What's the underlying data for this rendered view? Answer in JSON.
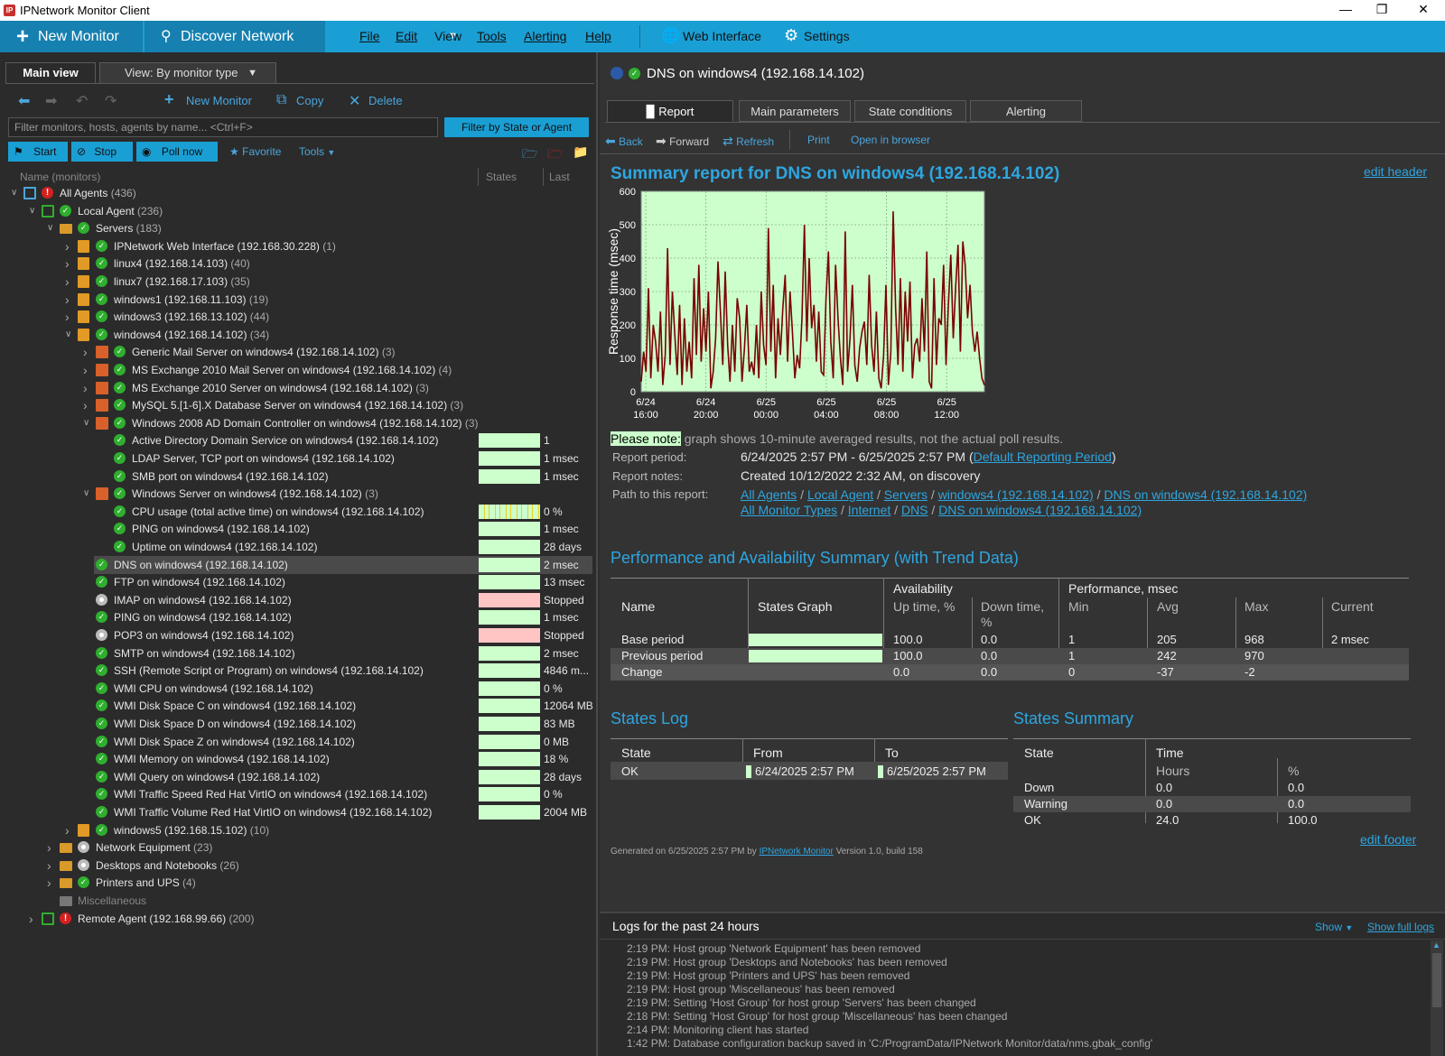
{
  "window": {
    "title": "IPNetwork Monitor Client",
    "logo": "IP"
  },
  "toolbar": {
    "new_monitor": "New Monitor",
    "discover": "Discover Network",
    "menus": [
      "File",
      "Edit",
      "View",
      "Tools",
      "Alerting",
      "Help"
    ],
    "web_interface": "Web Interface",
    "settings": "Settings"
  },
  "left": {
    "tab_main": "Main view",
    "tab_view": "View: By monitor type",
    "nav_new": "New Monitor",
    "nav_copy": "Copy",
    "nav_delete": "Delete",
    "filter_placeholder": "Filter monitors, hosts, agents by name... <Ctrl+F>",
    "filter_btn": "Filter by State or Agent",
    "btn_start": "Start",
    "btn_stop": "Stop",
    "btn_poll": "Poll now",
    "btn_favorite": "Favorite",
    "btn_tools": "Tools",
    "col_name": "Name (monitors)",
    "col_graph": "States Grap",
    "col_result": "Last Resu",
    "tree": [
      {
        "label": "All Agents",
        "count": "(436)",
        "level": 0,
        "icon": "agents",
        "status": "err",
        "expanded": true
      },
      {
        "label": "Local Agent",
        "count": "(236)",
        "level": 1,
        "icon": "agent",
        "status": "ok",
        "expanded": true
      },
      {
        "label": "Servers",
        "count": "(183)",
        "level": 2,
        "icon": "folder",
        "status": "ok",
        "expanded": true
      },
      {
        "label": "IPNetwork Web Interface (192.168.30.228)",
        "count": "(1)",
        "level": 3,
        "icon": "server",
        "status": "ok",
        "expanded": false
      },
      {
        "label": "linux4 (192.168.14.103)",
        "count": "(40)",
        "level": 3,
        "icon": "server",
        "status": "ok",
        "expanded": false
      },
      {
        "label": "linux7 (192.168.17.103)",
        "count": "(35)",
        "level": 3,
        "icon": "server",
        "status": "ok",
        "expanded": false
      },
      {
        "label": "windows1 (192.168.11.103)",
        "count": "(19)",
        "level": 3,
        "icon": "server",
        "status": "ok",
        "expanded": false
      },
      {
        "label": "windows3 (192.168.13.102)",
        "count": "(44)",
        "level": 3,
        "icon": "server",
        "status": "ok",
        "expanded": false
      },
      {
        "label": "windows4 (192.168.14.102)",
        "count": "(34)",
        "level": 3,
        "icon": "server",
        "status": "ok",
        "expanded": true
      },
      {
        "label": "Generic Mail Server on windows4 (192.168.14.102)",
        "count": "(3)",
        "level": 4,
        "icon": "mon",
        "status": "ok",
        "expanded": false
      },
      {
        "label": "MS Exchange 2010 Mail Server on windows4 (192.168.14.102)",
        "count": "(4)",
        "level": 4,
        "icon": "mon",
        "status": "ok",
        "expanded": false
      },
      {
        "label": "MS Exchange 2010 Server on windows4 (192.168.14.102)",
        "count": "(3)",
        "level": 4,
        "icon": "mon",
        "status": "ok",
        "expanded": false
      },
      {
        "label": "MySQL 5.[1-6].X Database Server on windows4 (192.168.14.102)",
        "count": "(3)",
        "level": 4,
        "icon": "mon",
        "status": "ok",
        "expanded": false
      },
      {
        "label": "Windows 2008 AD Domain Controller on windows4 (192.168.14.102)",
        "count": "(3)",
        "level": 4,
        "icon": "mon",
        "status": "ok",
        "expanded": true
      },
      {
        "label": "Active Directory Domain Service on windows4 (192.168.14.102)",
        "count": "",
        "level": 5,
        "icon": "none",
        "status": "ok",
        "graph": "green",
        "result": "1"
      },
      {
        "label": "LDAP Server, TCP port on windows4 (192.168.14.102)",
        "count": "",
        "level": 5,
        "icon": "none",
        "status": "ok",
        "graph": "green",
        "result": "1 msec"
      },
      {
        "label": "SMB port on windows4 (192.168.14.102)",
        "count": "",
        "level": 5,
        "icon": "none",
        "status": "ok",
        "graph": "green",
        "result": "1 msec"
      },
      {
        "label": "Windows Server on windows4 (192.168.14.102)",
        "count": "(3)",
        "level": 4,
        "icon": "mon",
        "status": "ok",
        "expanded": true
      },
      {
        "label": "CPU usage (total active time) on windows4 (192.168.14.102)",
        "count": "",
        "level": 5,
        "icon": "none",
        "status": "ok",
        "graph": "yellow",
        "result": "0 %"
      },
      {
        "label": "PING on windows4 (192.168.14.102)",
        "count": "",
        "level": 5,
        "icon": "none",
        "status": "ok",
        "graph": "green",
        "result": "1 msec"
      },
      {
        "label": "Uptime on windows4 (192.168.14.102)",
        "count": "",
        "level": 5,
        "icon": "none",
        "status": "ok",
        "graph": "green",
        "result": "28 days"
      },
      {
        "label": "DNS on windows4 (192.168.14.102)",
        "count": "",
        "level": 4,
        "icon": "none",
        "status": "ok",
        "graph": "green",
        "result": "2 msec",
        "selected": true
      },
      {
        "label": "FTP on windows4 (192.168.14.102)",
        "count": "",
        "level": 4,
        "icon": "none",
        "status": "ok",
        "graph": "green",
        "result": "13 msec"
      },
      {
        "label": "IMAP on windows4 (192.168.14.102)",
        "count": "",
        "level": 4,
        "icon": "none",
        "status": "gray",
        "graph": "pink",
        "result": "Stopped"
      },
      {
        "label": "PING on windows4 (192.168.14.102)",
        "count": "",
        "level": 4,
        "icon": "none",
        "status": "ok",
        "graph": "green",
        "result": "1 msec"
      },
      {
        "label": "POP3 on windows4 (192.168.14.102)",
        "count": "",
        "level": 4,
        "icon": "none",
        "status": "gray",
        "graph": "pink",
        "result": "Stopped"
      },
      {
        "label": "SMTP on windows4 (192.168.14.102)",
        "count": "",
        "level": 4,
        "icon": "none",
        "status": "ok",
        "graph": "green",
        "result": "2 msec"
      },
      {
        "label": "SSH (Remote Script or Program) on windows4 (192.168.14.102)",
        "count": "",
        "level": 4,
        "icon": "none",
        "status": "ok",
        "graph": "green",
        "result": "4846 m..."
      },
      {
        "label": "WMI CPU on windows4 (192.168.14.102)",
        "count": "",
        "level": 4,
        "icon": "none",
        "status": "ok",
        "graph": "green",
        "result": "0 %"
      },
      {
        "label": "WMI Disk Space C on windows4 (192.168.14.102)",
        "count": "",
        "level": 4,
        "icon": "none",
        "status": "ok",
        "graph": "green",
        "result": "12064 MB"
      },
      {
        "label": "WMI Disk Space D on windows4 (192.168.14.102)",
        "count": "",
        "level": 4,
        "icon": "none",
        "status": "ok",
        "graph": "green",
        "result": "83 MB"
      },
      {
        "label": "WMI Disk Space Z on windows4 (192.168.14.102)",
        "count": "",
        "level": 4,
        "icon": "none",
        "status": "ok",
        "graph": "green",
        "result": "0 MB"
      },
      {
        "label": "WMI Memory on windows4 (192.168.14.102)",
        "count": "",
        "level": 4,
        "icon": "none",
        "status": "ok",
        "graph": "green",
        "result": "18 %"
      },
      {
        "label": "WMI Query on windows4 (192.168.14.102)",
        "count": "",
        "level": 4,
        "icon": "none",
        "status": "ok",
        "graph": "green",
        "result": "28 days"
      },
      {
        "label": "WMI Traffic Speed Red Hat VirtIO on windows4 (192.168.14.102)",
        "count": "",
        "level": 4,
        "icon": "none",
        "status": "ok",
        "graph": "green",
        "result": "0 %"
      },
      {
        "label": "WMI Traffic Volume Red Hat VirtIO on windows4 (192.168.14.102)",
        "count": "",
        "level": 4,
        "icon": "none",
        "status": "ok",
        "graph": "green",
        "result": "2004 MB"
      },
      {
        "label": "windows5 (192.168.15.102)",
        "count": "(10)",
        "level": 3,
        "icon": "server",
        "status": "ok",
        "expanded": false
      },
      {
        "label": "Network Equipment",
        "count": "(23)",
        "level": 2,
        "icon": "folder",
        "status": "gray",
        "expanded": false
      },
      {
        "label": "Desktops and Notebooks",
        "count": "(26)",
        "level": 2,
        "icon": "folder",
        "status": "gray",
        "expanded": false
      },
      {
        "label": "Printers and UPS",
        "count": "(4)",
        "level": 2,
        "icon": "folder",
        "status": "ok",
        "expanded": false
      },
      {
        "label": "Miscellaneous",
        "count": "",
        "level": 2,
        "icon": "folder-gray",
        "status": "none",
        "dim": true
      },
      {
        "label": "Remote Agent (192.168.99.66)",
        "count": "(200)",
        "level": 1,
        "icon": "agent",
        "status": "err",
        "expanded": false
      }
    ]
  },
  "right": {
    "title": "DNS on windows4 (192.168.14.102)",
    "tabs": [
      "Report",
      "Main parameters",
      "State conditions",
      "Alerting"
    ],
    "nav": [
      "Back",
      "Forward",
      "Refresh",
      "Print",
      "Open in browser"
    ],
    "summary_title": "Summary report for DNS on windows4 (192.168.14.102)",
    "edit_header": "edit header",
    "note_label": "Please note:",
    "note_text": " graph shows 10-minute averaged results, not the actual poll results.",
    "period_label": "Report period:",
    "period_value": "6/24/2025 2:57 PM - 6/25/2025 2:57 PM (",
    "period_link": "Default Reporting Period",
    "period_close": ")",
    "notes_label": "Report notes:",
    "notes_value": "Created 10/12/2022 2:32 AM, on discovery",
    "path_label": "Path to this report:",
    "path1": [
      "All Agents",
      "Local Agent",
      "Servers",
      "windows4 (192.168.14.102)",
      "DNS on windows4 (192.168.14.102)"
    ],
    "path2": [
      "All Monitor Types",
      "Internet",
      "DNS",
      "DNS on windows4 (192.168.14.102)"
    ],
    "perf_title": "Performance and Availability Summary (with Trend Data)",
    "perf": {
      "h_name": "Name",
      "h_graph": "States Graph",
      "h_avail": "Availability",
      "h_up": "Up time, %",
      "h_down1": "Down time,",
      "h_down2": "%",
      "h_perf": "Performance, msec",
      "h_min": "Min",
      "h_avg": "Avg",
      "h_max": "Max",
      "h_cur": "Current",
      "rows": [
        {
          "name": "Base period",
          "up": "100.0",
          "down": "0.0",
          "min": "1",
          "avg": "205",
          "max": "968",
          "cur": "2 msec"
        },
        {
          "name": "Previous period",
          "up": "100.0",
          "down": "0.0",
          "min": "1",
          "avg": "242",
          "max": "970",
          "cur": ""
        },
        {
          "name": "Change",
          "up": "0.0",
          "down": "0.0",
          "min": "0",
          "avg": "-37",
          "max": "-2",
          "cur": ""
        }
      ]
    },
    "states_log_title": "States Log",
    "states_log": {
      "h_state": "State",
      "h_from": "From",
      "h_to": "To",
      "state": "OK",
      "from": "6/24/2025 2:57 PM",
      "to": "6/25/2025 2:57 PM"
    },
    "states_summary_title": "States Summary",
    "states_summary": {
      "h_state": "State",
      "h_time": "Time",
      "h_hours": "Hours",
      "h_pct": "%",
      "rows": [
        {
          "state": "Down",
          "hours": "0.0",
          "pct": "0.0"
        },
        {
          "state": "Warning",
          "hours": "0.0",
          "pct": "0.0"
        },
        {
          "state": "OK",
          "hours": "24.0",
          "pct": "100.0"
        }
      ]
    },
    "generated_prefix": "Generated on 6/25/2025 2:57 PM by ",
    "generated_link": "IPNetwork Monitor",
    "generated_suffix": " Version 1.0, build 158",
    "edit_footer": "edit footer"
  },
  "chart_data": {
    "type": "line",
    "title": "",
    "xlabel": "",
    "ylabel": "Response time (msec)",
    "ylim": [
      0,
      600
    ],
    "yticks": [
      0,
      100,
      200,
      300,
      400,
      500,
      600
    ],
    "xticks": [
      {
        "l1": "6/24",
        "l2": "16:00"
      },
      {
        "l1": "6/24",
        "l2": "20:00"
      },
      {
        "l1": "6/25",
        "l2": "00:00"
      },
      {
        "l1": "6/25",
        "l2": "04:00"
      },
      {
        "l1": "6/25",
        "l2": "08:00"
      },
      {
        "l1": "6/25",
        "l2": "12:00"
      }
    ],
    "grid": true,
    "background": "#ccffcc",
    "line_color": "#7a0000",
    "values": [
      30,
      120,
      60,
      310,
      40,
      200,
      150,
      60,
      240,
      20,
      110,
      430,
      80,
      300,
      170,
      50,
      260,
      20,
      220,
      60,
      150,
      40,
      340,
      110,
      380,
      90,
      250,
      120,
      300,
      10,
      60,
      160,
      390,
      240,
      80,
      360,
      140,
      30,
      200,
      60,
      280,
      220,
      30,
      130,
      260,
      60,
      90,
      50,
      200,
      40,
      300,
      140,
      80,
      490,
      120,
      320,
      40,
      220,
      110,
      250,
      350,
      90,
      300,
      180,
      40,
      110,
      70,
      220,
      500,
      150,
      400,
      190,
      260,
      90,
      240,
      60,
      50,
      280,
      420,
      150,
      40,
      380,
      220,
      100,
      20,
      480,
      60,
      160,
      320,
      80,
      30,
      130,
      180,
      210,
      80,
      350,
      140,
      60,
      240,
      40,
      10,
      110,
      320,
      20,
      120,
      540,
      250,
      80,
      340,
      60,
      300,
      150,
      330,
      40,
      140,
      160,
      90,
      280,
      120,
      420,
      30,
      10,
      340,
      80,
      220,
      200,
      380,
      80,
      260,
      410,
      160,
      310,
      440,
      120,
      450,
      380,
      220,
      320,
      180,
      120,
      180,
      100,
      40,
      20
    ]
  },
  "logs": {
    "title": "Logs for the past 24 hours",
    "show": "Show",
    "show_full": "Show full logs",
    "lines": [
      "2:19 PM: Host group 'Network Equipment' has been removed",
      "2:19 PM: Host group 'Desktops and Notebooks' has been removed",
      "2:19 PM: Host group 'Printers and UPS' has been removed",
      "2:19 PM: Host group 'Miscellaneous' has been removed",
      "2:19 PM: Setting 'Host Group' for host group 'Servers' has been changed",
      "2:18 PM: Setting 'Host Group' for host group 'Miscellaneous' has been changed",
      "2:14 PM: Monitoring client has started",
      "1:42 PM: Database configuration backup saved in 'C:/ProgramData/IPNetwork Monitor/data/nms.gbak_config'"
    ]
  }
}
